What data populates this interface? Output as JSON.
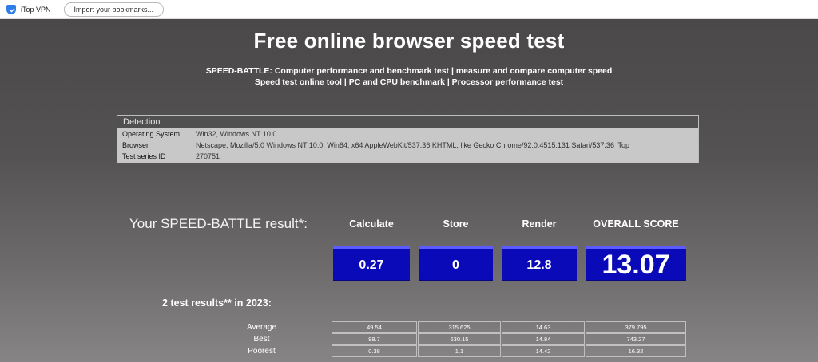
{
  "bookmarks": {
    "item1_label": "iTop VPN",
    "import_label": "Import your bookmarks..."
  },
  "header": {
    "title": "Free online browser speed test",
    "subtitle_line1": "SPEED-BATTLE: Computer performance and benchmark test | measure and compare computer speed",
    "subtitle_line2": "Speed test online tool | PC and CPU benchmark | Processor performance test"
  },
  "detection": {
    "heading": "Detection",
    "rows": [
      {
        "key": "Operating System",
        "value": "Win32, Windows NT 10.0"
      },
      {
        "key": "Browser",
        "value": "Netscape, Mozilla/5.0 Windows NT 10.0; Win64; x64 AppleWebKit/537.36 KHTML, like Gecko Chrome/92.0.4515.131 Safari/537.36 iTop"
      },
      {
        "key": "Test series ID",
        "value": "270751"
      }
    ]
  },
  "result": {
    "label": "Your SPEED-BATTLE result*:",
    "columns": [
      "Calculate",
      "Store",
      "Render",
      "OVERALL SCORE"
    ],
    "scores": [
      "0.27",
      "0",
      "12.8",
      "13.07"
    ],
    "test_count": "2 test results** in 2023:"
  },
  "stats": [
    {
      "label": "Average",
      "values": [
        "49.54",
        "315.625",
        "14.63",
        "379.795"
      ]
    },
    {
      "label": "Best",
      "values": [
        "98.7",
        "630.15",
        "14.84",
        "743.27"
      ]
    },
    {
      "label": "Poorest",
      "values": [
        "0.38",
        "1.1",
        "14.42",
        "16.32"
      ]
    }
  ],
  "colors": {
    "score_box": "#0a0ab8",
    "score_box_top": "#5b5bff"
  }
}
